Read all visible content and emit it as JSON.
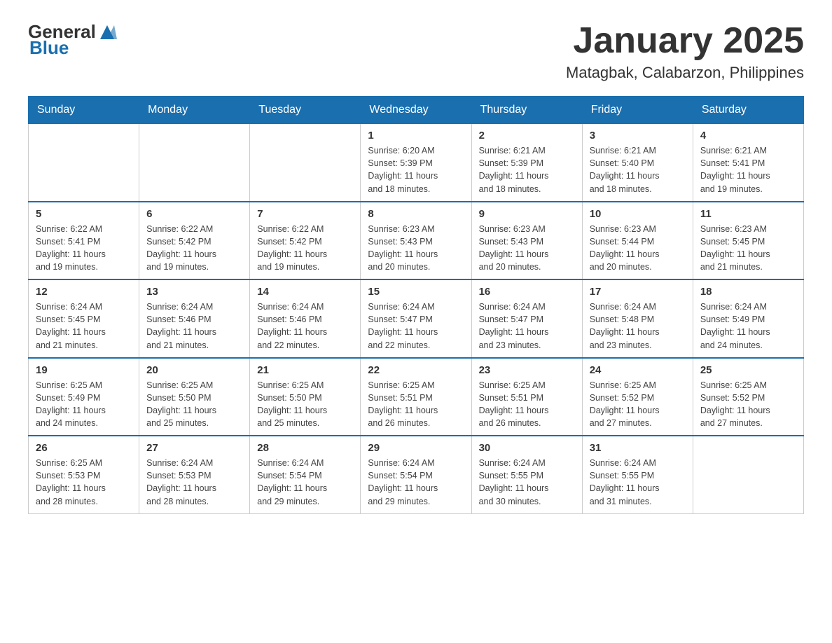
{
  "header": {
    "logo": {
      "general": "General",
      "blue": "Blue"
    },
    "title": "January 2025",
    "subtitle": "Matagbak, Calabarzon, Philippines"
  },
  "calendar": {
    "weekdays": [
      "Sunday",
      "Monday",
      "Tuesday",
      "Wednesday",
      "Thursday",
      "Friday",
      "Saturday"
    ],
    "weeks": [
      [
        {
          "day": "",
          "info": ""
        },
        {
          "day": "",
          "info": ""
        },
        {
          "day": "",
          "info": ""
        },
        {
          "day": "1",
          "info": "Sunrise: 6:20 AM\nSunset: 5:39 PM\nDaylight: 11 hours\nand 18 minutes."
        },
        {
          "day": "2",
          "info": "Sunrise: 6:21 AM\nSunset: 5:39 PM\nDaylight: 11 hours\nand 18 minutes."
        },
        {
          "day": "3",
          "info": "Sunrise: 6:21 AM\nSunset: 5:40 PM\nDaylight: 11 hours\nand 18 minutes."
        },
        {
          "day": "4",
          "info": "Sunrise: 6:21 AM\nSunset: 5:41 PM\nDaylight: 11 hours\nand 19 minutes."
        }
      ],
      [
        {
          "day": "5",
          "info": "Sunrise: 6:22 AM\nSunset: 5:41 PM\nDaylight: 11 hours\nand 19 minutes."
        },
        {
          "day": "6",
          "info": "Sunrise: 6:22 AM\nSunset: 5:42 PM\nDaylight: 11 hours\nand 19 minutes."
        },
        {
          "day": "7",
          "info": "Sunrise: 6:22 AM\nSunset: 5:42 PM\nDaylight: 11 hours\nand 19 minutes."
        },
        {
          "day": "8",
          "info": "Sunrise: 6:23 AM\nSunset: 5:43 PM\nDaylight: 11 hours\nand 20 minutes."
        },
        {
          "day": "9",
          "info": "Sunrise: 6:23 AM\nSunset: 5:43 PM\nDaylight: 11 hours\nand 20 minutes."
        },
        {
          "day": "10",
          "info": "Sunrise: 6:23 AM\nSunset: 5:44 PM\nDaylight: 11 hours\nand 20 minutes."
        },
        {
          "day": "11",
          "info": "Sunrise: 6:23 AM\nSunset: 5:45 PM\nDaylight: 11 hours\nand 21 minutes."
        }
      ],
      [
        {
          "day": "12",
          "info": "Sunrise: 6:24 AM\nSunset: 5:45 PM\nDaylight: 11 hours\nand 21 minutes."
        },
        {
          "day": "13",
          "info": "Sunrise: 6:24 AM\nSunset: 5:46 PM\nDaylight: 11 hours\nand 21 minutes."
        },
        {
          "day": "14",
          "info": "Sunrise: 6:24 AM\nSunset: 5:46 PM\nDaylight: 11 hours\nand 22 minutes."
        },
        {
          "day": "15",
          "info": "Sunrise: 6:24 AM\nSunset: 5:47 PM\nDaylight: 11 hours\nand 22 minutes."
        },
        {
          "day": "16",
          "info": "Sunrise: 6:24 AM\nSunset: 5:47 PM\nDaylight: 11 hours\nand 23 minutes."
        },
        {
          "day": "17",
          "info": "Sunrise: 6:24 AM\nSunset: 5:48 PM\nDaylight: 11 hours\nand 23 minutes."
        },
        {
          "day": "18",
          "info": "Sunrise: 6:24 AM\nSunset: 5:49 PM\nDaylight: 11 hours\nand 24 minutes."
        }
      ],
      [
        {
          "day": "19",
          "info": "Sunrise: 6:25 AM\nSunset: 5:49 PM\nDaylight: 11 hours\nand 24 minutes."
        },
        {
          "day": "20",
          "info": "Sunrise: 6:25 AM\nSunset: 5:50 PM\nDaylight: 11 hours\nand 25 minutes."
        },
        {
          "day": "21",
          "info": "Sunrise: 6:25 AM\nSunset: 5:50 PM\nDaylight: 11 hours\nand 25 minutes."
        },
        {
          "day": "22",
          "info": "Sunrise: 6:25 AM\nSunset: 5:51 PM\nDaylight: 11 hours\nand 26 minutes."
        },
        {
          "day": "23",
          "info": "Sunrise: 6:25 AM\nSunset: 5:51 PM\nDaylight: 11 hours\nand 26 minutes."
        },
        {
          "day": "24",
          "info": "Sunrise: 6:25 AM\nSunset: 5:52 PM\nDaylight: 11 hours\nand 27 minutes."
        },
        {
          "day": "25",
          "info": "Sunrise: 6:25 AM\nSunset: 5:52 PM\nDaylight: 11 hours\nand 27 minutes."
        }
      ],
      [
        {
          "day": "26",
          "info": "Sunrise: 6:25 AM\nSunset: 5:53 PM\nDaylight: 11 hours\nand 28 minutes."
        },
        {
          "day": "27",
          "info": "Sunrise: 6:24 AM\nSunset: 5:53 PM\nDaylight: 11 hours\nand 28 minutes."
        },
        {
          "day": "28",
          "info": "Sunrise: 6:24 AM\nSunset: 5:54 PM\nDaylight: 11 hours\nand 29 minutes."
        },
        {
          "day": "29",
          "info": "Sunrise: 6:24 AM\nSunset: 5:54 PM\nDaylight: 11 hours\nand 29 minutes."
        },
        {
          "day": "30",
          "info": "Sunrise: 6:24 AM\nSunset: 5:55 PM\nDaylight: 11 hours\nand 30 minutes."
        },
        {
          "day": "31",
          "info": "Sunrise: 6:24 AM\nSunset: 5:55 PM\nDaylight: 11 hours\nand 31 minutes."
        },
        {
          "day": "",
          "info": ""
        }
      ]
    ]
  }
}
